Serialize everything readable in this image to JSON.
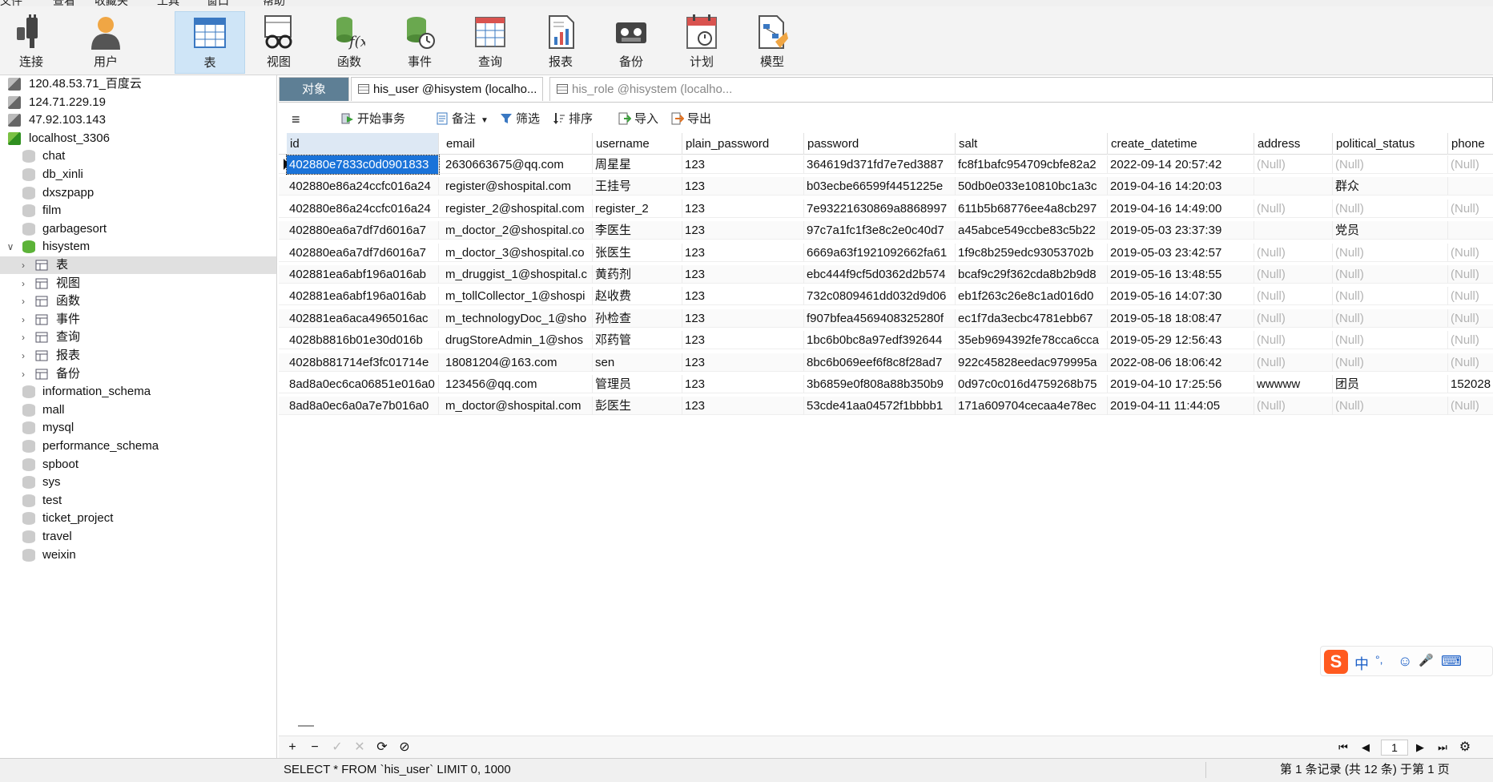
{
  "menubar": [
    "文件",
    "查看",
    "收藏夹",
    "工具",
    "窗口",
    "帮助"
  ],
  "toolbar": {
    "buttons": [
      {
        "label": "连接",
        "icon": "plug-icon"
      },
      {
        "label": "用户",
        "icon": "user-icon"
      },
      {
        "label": "表",
        "icon": "table-icon"
      },
      {
        "label": "视图",
        "icon": "glasses-icon"
      },
      {
        "label": "函数",
        "icon": "function-icon"
      },
      {
        "label": "事件",
        "icon": "event-clock-icon"
      },
      {
        "label": "查询",
        "icon": "query-grid-icon"
      },
      {
        "label": "报表",
        "icon": "report-icon"
      },
      {
        "label": "备份",
        "icon": "backup-tape-icon"
      },
      {
        "label": "计划",
        "icon": "calendar-icon"
      },
      {
        "label": "模型",
        "icon": "model-icon"
      }
    ]
  },
  "sidebar": {
    "connections": [
      {
        "label": "120.48.53.71_百度云"
      },
      {
        "label": "124.71.229.19"
      },
      {
        "label": "47.92.103.143"
      },
      {
        "label": "localhost_3306"
      }
    ],
    "databases_before": [
      "chat",
      "db_xinli",
      "dxszpapp",
      "film",
      "garbagesort"
    ],
    "open_db": "hisystem",
    "children": [
      {
        "label": "表",
        "icon": "table-icon"
      },
      {
        "label": "视图",
        "icon": "glasses-icon"
      },
      {
        "label": "函数",
        "icon": "function-icon"
      },
      {
        "label": "事件",
        "icon": "event-clock-icon"
      },
      {
        "label": "查询",
        "icon": "query-grid-icon"
      },
      {
        "label": "报表",
        "icon": "report-icon"
      },
      {
        "label": "备份",
        "icon": "backup-tape-icon"
      }
    ],
    "databases_after": [
      "information_schema",
      "mall",
      "mysql",
      "performance_schema",
      "spboot",
      "sys",
      "test",
      "ticket_project",
      "travel",
      "weixin"
    ]
  },
  "tabs": {
    "objects": "对象",
    "tab1": "his_user @hisystem (localho...",
    "tab2": "his_role @hisystem (localho..."
  },
  "subtoolbar": {
    "menu": "≡",
    "begin_transaction": "开始事务",
    "memo": "备注",
    "filter": "筛选",
    "sort": "排序",
    "import": "导入",
    "export": "导出"
  },
  "grid": {
    "columns": [
      "id",
      "email",
      "username",
      "plain_password",
      "password",
      "salt",
      "create_datetime",
      "address",
      "political_status",
      "phone"
    ],
    "rows": [
      [
        "402880e7833c0d0901833",
        "2630663675@qq.com",
        "周星星",
        "123",
        "364619d371fd7e7ed3887",
        "fc8f1bafc954709cbfe82a2",
        "2022-09-14 20:57:42",
        "(Null)",
        "(Null)",
        "(Null)"
      ],
      [
        "402880e86a24ccfc016a24",
        "register@shospital.com",
        "王挂号",
        "123",
        "b03ecbe66599f4451225e",
        "50db0e033e10810bc1a3c",
        "2019-04-16 14:20:03",
        "",
        "群众",
        ""
      ],
      [
        "402880e86a24ccfc016a24",
        "register_2@shospital.com",
        "register_2",
        "123",
        "7e93221630869a8868997",
        "611b5b68776ee4a8cb297",
        "2019-04-16 14:49:00",
        "(Null)",
        "(Null)",
        "(Null)"
      ],
      [
        "402880ea6a7df7d6016a7",
        "m_doctor_2@shospital.co",
        "李医生",
        "123",
        "97c7a1fc1f3e8c2e0c40d7",
        "a45abce549ccbe83c5b22",
        "2019-05-03 23:37:39",
        "",
        "党员",
        ""
      ],
      [
        "402880ea6a7df7d6016a7",
        "m_doctor_3@shospital.co",
        "张医生",
        "123",
        "6669a63f1921092662fa61",
        "1f9c8b259edc93053702b",
        "2019-05-03 23:42:57",
        "(Null)",
        "(Null)",
        "(Null)"
      ],
      [
        "402881ea6abf196a016ab",
        "m_druggist_1@shospital.c",
        "黄药剂",
        "123",
        "ebc444f9cf5d0362d2b574",
        "bcaf9c29f362cda8b2b9d8",
        "2019-05-16 13:48:55",
        "(Null)",
        "(Null)",
        "(Null)"
      ],
      [
        "402881ea6abf196a016ab",
        "m_tollCollector_1@shospi",
        "赵收费",
        "123",
        "732c0809461dd032d9d06",
        "eb1f263c26e8c1ad016d0",
        "2019-05-16 14:07:30",
        "(Null)",
        "(Null)",
        "(Null)"
      ],
      [
        "402881ea6aca4965016ac",
        "m_technologyDoc_1@sho",
        "孙检查",
        "123",
        "f907bfea4569408325280f",
        "ec1f7da3ecbc4781ebb67",
        "2019-05-18 18:08:47",
        "(Null)",
        "(Null)",
        "(Null)"
      ],
      [
        "4028b8816b01e30d016b",
        "drugStoreAdmin_1@shos",
        "邓药管",
        "123",
        "1bc6b0bc8a97edf392644",
        "35eb9694392fe78cca6cca",
        "2019-05-29 12:56:43",
        "(Null)",
        "(Null)",
        "(Null)"
      ],
      [
        "4028b881714ef3fc01714e",
        "18081204@163.com",
        "sen",
        "123",
        "8bc6b069eef6f8c8f28ad7",
        "922c45828eedac979995a",
        "2022-08-06 18:06:42",
        "(Null)",
        "(Null)",
        "(Null)"
      ],
      [
        "8ad8a0ec6ca06851e016a0",
        "123456@qq.com",
        "管理员",
        "123",
        "3b6859e0f808a88b350b9",
        "0d97c0c016d4759268b75",
        "2019-04-10 17:25:56",
        "wwwww",
        "团员",
        "152028"
      ],
      [
        "8ad8a0ec6a0a7e7b016a0",
        "m_doctor@shospital.com",
        "彭医生",
        "123",
        "53cde41aa04572f1bbbb1",
        "171a609704cecaa4e78ec",
        "2019-04-11 11:44:05",
        "(Null)",
        "(Null)",
        "(Null)"
      ]
    ]
  },
  "navbar": {
    "add": "+",
    "remove": "−",
    "apply": "✓",
    "discard": "✕",
    "refresh": "⟳",
    "stop": "⊘",
    "first": "⏮",
    "prev": "◀",
    "page": "1",
    "next": "▶",
    "last": "⏭",
    "settings": "⚙"
  },
  "status": {
    "sql": "SELECT * FROM `his_user` LIMIT 0, 1000",
    "records": "第 1 条记录 (共 12 条) 于第 1 页"
  },
  "ime": {
    "logo": "S",
    "mode": "中",
    "punct": "°,",
    "emoji": "☺",
    "mic": "🎤",
    "keyboard": "⌨"
  }
}
